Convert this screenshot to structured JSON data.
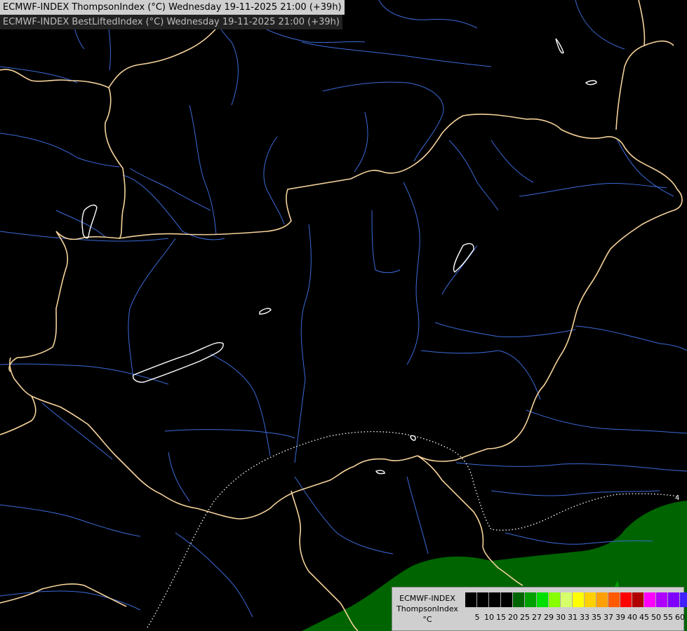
{
  "header": {
    "title_primary": "ECMWF-INDEX ThompsonIndex (°C) Wednesday 19-11-2025 21:00 (+39h)",
    "title_secondary": "ECMWF-INDEX BestLiftedIndex (°C) Wednesday 19-11-2025 21:00 (+39h)"
  },
  "map": {
    "background": "#000000",
    "border_color": "#f5d29a",
    "river_color": "#3c6ad8",
    "lake_color": "#ffffff",
    "isoline_color": "#ffffff",
    "isoline_label": "4",
    "field_colors": [
      "#006400",
      "#00c000"
    ]
  },
  "legend": {
    "title_lines": [
      "ECMWF-INDEX",
      "ThompsonIndex",
      "°C"
    ],
    "colors": [
      "#000000",
      "#000000",
      "#000000",
      "#000000",
      "#006400",
      "#00a000",
      "#00e000",
      "#88ff00",
      "#d6ff6a",
      "#ffff00",
      "#ffd100",
      "#ff9f00",
      "#ff5a00",
      "#ff0000",
      "#b00000",
      "#ff00ff",
      "#b000ff",
      "#8000ff",
      "#4020ff",
      "#0000ff"
    ],
    "ticks": [
      "5",
      "10",
      "15",
      "20",
      "25",
      "27",
      "29",
      "30",
      "31",
      "33",
      "35",
      "37",
      "39",
      "40",
      "45",
      "50",
      "55",
      "60"
    ]
  }
}
